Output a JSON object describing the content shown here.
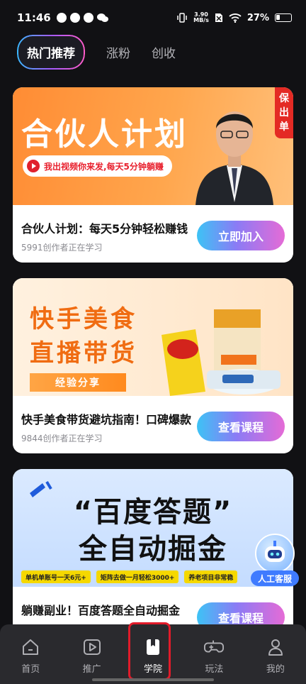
{
  "status_bar": {
    "time": "11:46",
    "net_speed_value": "3.90",
    "net_speed_unit": "MB/s",
    "battery_percent": "27%"
  },
  "tabs": [
    {
      "label": "热门推荐",
      "active": true
    },
    {
      "label": "涨粉",
      "active": false
    },
    {
      "label": "创收",
      "active": false
    }
  ],
  "cards": [
    {
      "banner_title": "合伙人计划",
      "banner_pill": "我出视频你来发,每天5分钟躺赚",
      "banner_badge": "保出单",
      "title": "合伙人计划：每天5分钟轻松赚钱",
      "subtitle": "5991创作者正在学习",
      "button": "立即加入"
    },
    {
      "banner_title_line1": "快手美食",
      "banner_title_line2": "直播带货",
      "banner_tag": "经验分享",
      "title": "快手美食带货避坑指南！口碑爆款",
      "subtitle": "9844创作者正在学习",
      "button": "查看课程"
    },
    {
      "banner_title_line1": "“百度答题”",
      "banner_title_line2": "全自动掘金",
      "chips": [
        "单机单账号一天6元+",
        "矩阵去做一月轻松3000+",
        "养老项目非常稳"
      ],
      "title": "躺赚副业！百度答题全自动掘金",
      "button": "查看课程"
    }
  ],
  "customer_service": {
    "label": "人工客服"
  },
  "bottom_nav": [
    {
      "label": "首页",
      "icon": "home-icon"
    },
    {
      "label": "推广",
      "icon": "play-icon"
    },
    {
      "label": "学院",
      "icon": "book-icon",
      "active": true
    },
    {
      "label": "玩法",
      "icon": "gamepad-icon"
    },
    {
      "label": "我的",
      "icon": "user-icon"
    }
  ],
  "colors": {
    "background": "#111114",
    "button_gradient_start": "#3dc3f5",
    "button_gradient_end": "#e56bd6",
    "highlight_box": "#e11b2a"
  }
}
